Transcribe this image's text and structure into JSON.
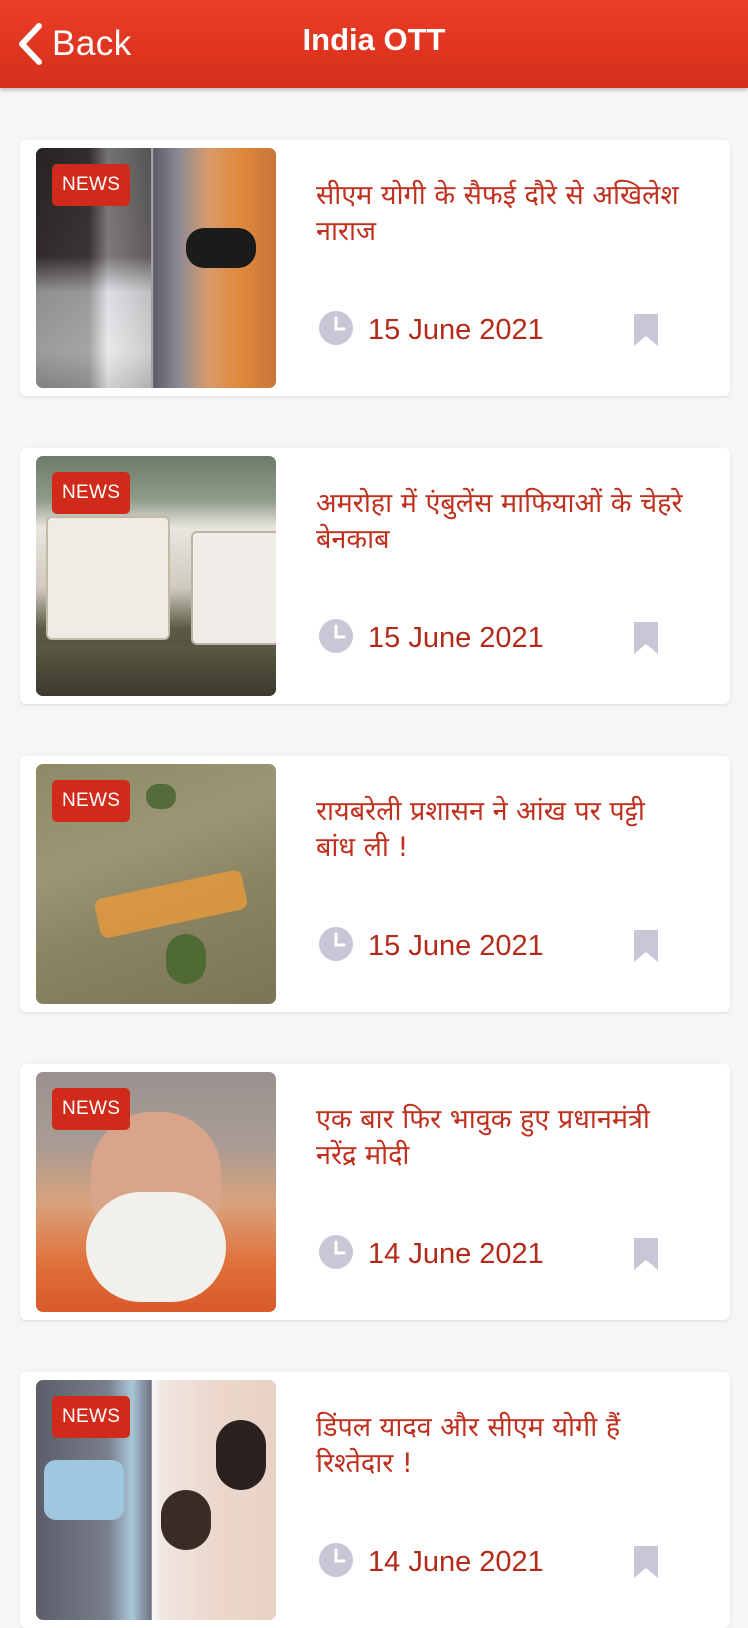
{
  "header": {
    "back_label": "Back",
    "title": "India OTT"
  },
  "colors": {
    "header_bg": "#e33a22",
    "badge_bg": "#cf2a1a",
    "headline_text": "#c0301e",
    "icon_grey": "#c9c7d6"
  },
  "articles": [
    {
      "badge": "NEWS",
      "headline": "सीएम योगी के सैफई दौरे से अखिलेश नाराज",
      "date": "15 June 2021",
      "icons": [
        "clock-icon",
        "bookmark-icon"
      ]
    },
    {
      "badge": "NEWS",
      "headline": "अमरोहा में एंबुलेंस माफियाओं के चेहरे बेनकाब",
      "date": "15 June 2021",
      "icons": [
        "clock-icon",
        "bookmark-icon"
      ]
    },
    {
      "badge": "NEWS",
      "headline": "रायबरेली प्रशासन ने आंख पर पट्टी बांध ली !",
      "date": "15 June 2021",
      "icons": [
        "clock-icon",
        "bookmark-icon"
      ]
    },
    {
      "badge": "NEWS",
      "headline": "एक बार फिर भावुक हुए प्रधानमंत्री नरेंद्र मोदी",
      "date": "14 June 2021",
      "icons": [
        "clock-icon",
        "bookmark-icon"
      ]
    },
    {
      "badge": "NEWS",
      "headline": "डिंपल यादव और सीएम योगी हैं रिश्तेदार !",
      "date": "14 June 2021",
      "icons": [
        "clock-icon",
        "bookmark-icon"
      ]
    }
  ]
}
